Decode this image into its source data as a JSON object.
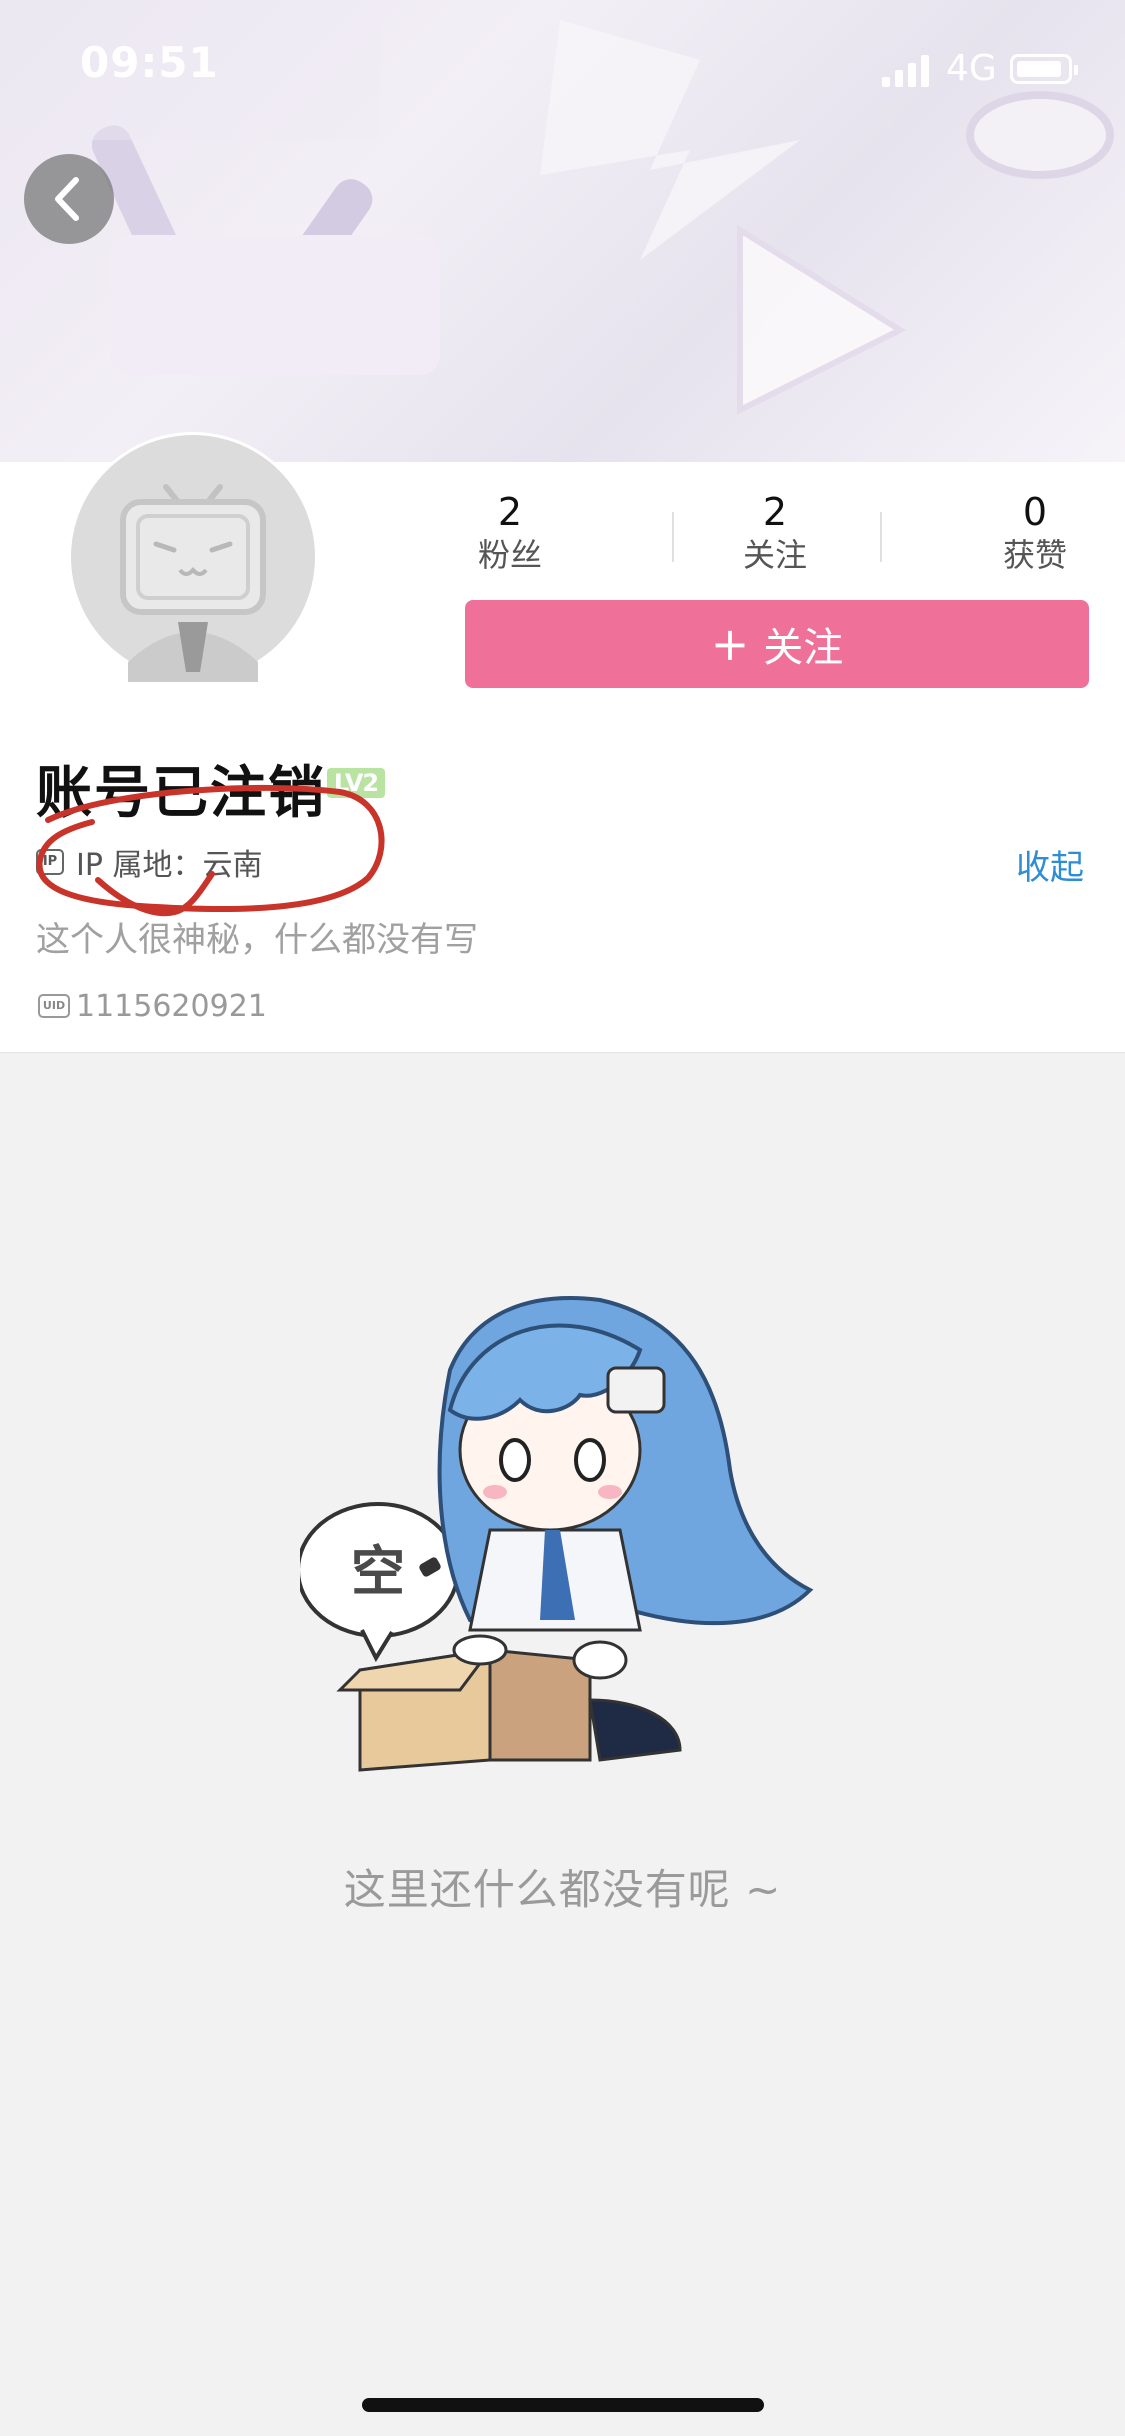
{
  "status_bar": {
    "time": "09:51",
    "network": "4G"
  },
  "icons": {
    "back": "chevron-left-icon",
    "ip": "ip-location-icon",
    "uid": "uid-icon",
    "signal": "signal-icon",
    "battery": "battery-icon"
  },
  "stats": [
    {
      "value": "2",
      "label": "粉丝"
    },
    {
      "value": "2",
      "label": "关注"
    },
    {
      "value": "0",
      "label": "获赞"
    }
  ],
  "follow_button": {
    "plus": "+",
    "label": "关注"
  },
  "profile": {
    "username": "账号已注销",
    "level": "LV2",
    "ip_icon_text": "IP",
    "ip_location": "IP 属地：云南",
    "collapse": "收起",
    "bio": "这个人很神秘，什么都没有写",
    "uid_icon_text": "UID",
    "uid": "1115620921"
  },
  "empty_state": {
    "bubble": "空",
    "message": "这里还什么都没有呢 ~"
  },
  "colors": {
    "accent_pink": "#ef719a",
    "link_blue": "#2f8ed3",
    "level_green": "#b8e3a0",
    "annotation_red": "#c8342a"
  }
}
